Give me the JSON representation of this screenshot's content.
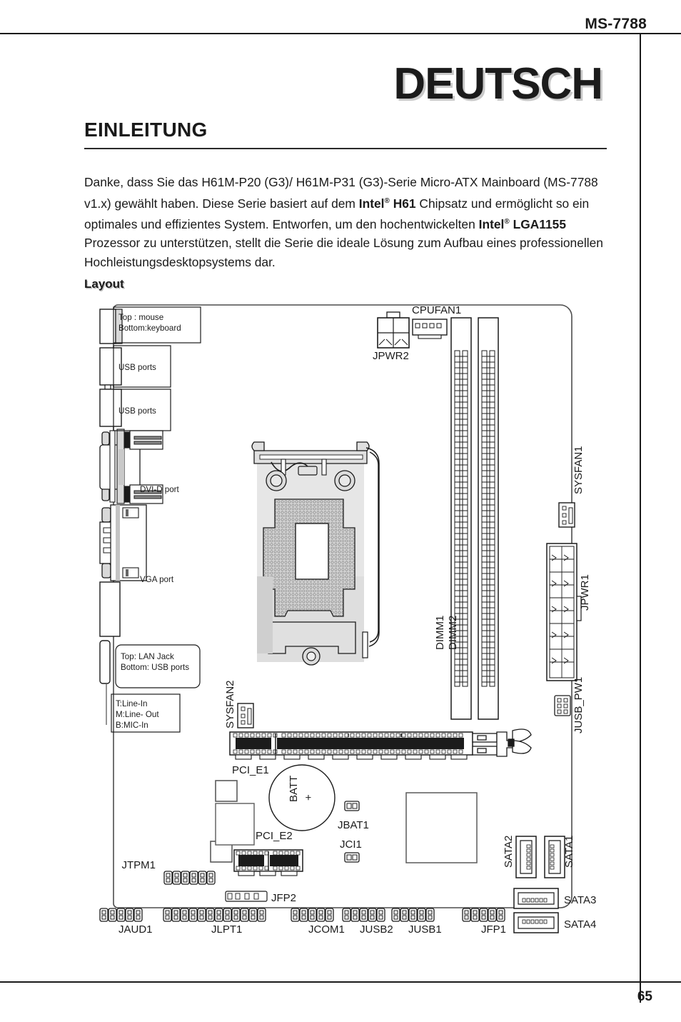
{
  "header": {
    "model_code": "MS-7788",
    "page_number": "65"
  },
  "language_title": "DEUTSCH",
  "section": {
    "title": "EINLEITUNG",
    "paragraph_parts": [
      {
        "text": "Danke, dass Sie das H61M-P20 (G3)/ H61M-P31 (G3)-Serie Micro-ATX Mainboard (MS-7788 v1.x) gewählt haben. Diese Serie basiert auf dem ",
        "bold": false
      },
      {
        "text": "Intel",
        "bold": true
      },
      {
        "text": "®",
        "bold": true,
        "sup": true
      },
      {
        "text": " H61",
        "bold": true
      },
      {
        "text": " Chipsatz und ermöglicht so ein optimales und effizientes System. Entworfen, um den hochentwickelten ",
        "bold": false
      },
      {
        "text": "Intel",
        "bold": true
      },
      {
        "text": "®",
        "bold": true,
        "sup": true
      },
      {
        "text": " LGA1155",
        "bold": true
      },
      {
        "text": " Prozessor zu unterstützen, stellt die Serie die ideale Lösung zum Aufbau eines professionellen Hochleistungsdesktopsystems dar.",
        "bold": false
      }
    ],
    "subsection_title": "Layout"
  },
  "diagram": {
    "callouts": {
      "ps2": "Top : mouse\nBottom:keyboard",
      "ps2_line1": "Top : mouse",
      "ps2_line2": "Bottom:keyboard",
      "usb_top": "USB ports",
      "usb_mid": "USB ports",
      "dvi": "DVI-D port",
      "vga": "VGA port",
      "lan_line1": "Top: LAN Jack",
      "lan_line2": "Bottom: USB ports",
      "audio_line1": "T:Line-In",
      "audio_line2": "M:Line- Out",
      "audio_line3": "B:MIC-In"
    },
    "labels": {
      "cpufan1": "CPUFAN1",
      "jpwr2": "JPWR2",
      "sysfan1": "SYSFAN1",
      "jpwr1": "JPWR1",
      "jusb_pw1": "JUSB_PW1",
      "dimm1": "DIMM1",
      "dimm2": "DIMM2",
      "sysfan2": "SYSFAN2",
      "pci_e1": "PCI_E1",
      "pci_e2": "PCI_E2",
      "batt": "BATT",
      "batt_plus": "+",
      "jbat1": "JBAT1",
      "jci1": "JCI1",
      "jtpm1": "JTPM1",
      "jfp2": "JFP2",
      "jaud1": "JAUD1",
      "jlpt1": "JLPT1",
      "jcom1": "JCOM1",
      "jusb2": "JUSB2",
      "jusb1": "JUSB1",
      "jfp1": "JFP1",
      "sata1": "SATA1",
      "sata2": "SATA2",
      "sata3": "SATA3",
      "sata4": "SATA4"
    },
    "colors": {
      "outline": "#1b1b1b",
      "fill_light": "#d9d9d9",
      "fill_mid": "#bdbdbd",
      "paper": "#ffffff"
    }
  }
}
